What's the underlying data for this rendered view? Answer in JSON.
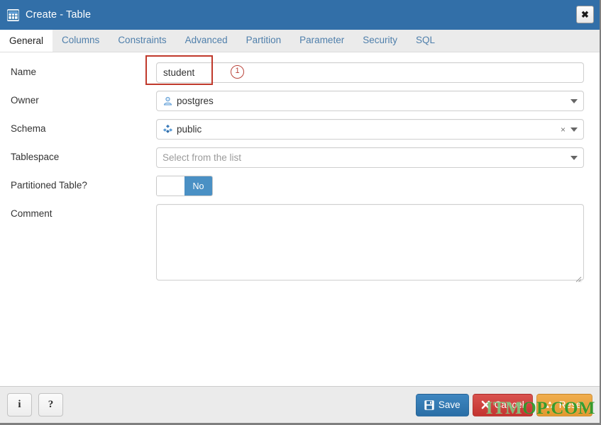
{
  "window": {
    "title": "Create - Table",
    "icon": "table-icon",
    "close_label": "✖",
    "titlebar_color": "#326fa8"
  },
  "tabs": [
    {
      "label": "General",
      "active": true
    },
    {
      "label": "Columns",
      "active": false
    },
    {
      "label": "Constraints",
      "active": false
    },
    {
      "label": "Advanced",
      "active": false
    },
    {
      "label": "Partition",
      "active": false
    },
    {
      "label": "Parameter",
      "active": false
    },
    {
      "label": "Security",
      "active": false
    },
    {
      "label": "SQL",
      "active": false
    }
  ],
  "form": {
    "name": {
      "label": "Name",
      "value": "student",
      "annotation_number": "1",
      "annotation_color": "#c0392b"
    },
    "owner": {
      "label": "Owner",
      "value": "postgres",
      "icon": "user-icon"
    },
    "schema": {
      "label": "Schema",
      "value": "public",
      "icon": "schema-icon",
      "clear_label": "×"
    },
    "tablespace": {
      "label": "Tablespace",
      "value": "",
      "placeholder": "Select from the list"
    },
    "partitioned": {
      "label": "Partitioned Table?",
      "value": "No"
    },
    "comment": {
      "label": "Comment",
      "value": "",
      "placeholder": ""
    }
  },
  "footer": {
    "info_label": "i",
    "help_label": "?",
    "save_label": "Save",
    "cancel_label": "Cancel",
    "reset_label": "Reset",
    "save_color": "#2a6ea6",
    "cancel_color": "#c3332f",
    "reset_color": "#e2982f"
  },
  "watermark": {
    "prefix": "ITM",
    "suffix": "OP.COM",
    "color": "#2a9a2a"
  }
}
